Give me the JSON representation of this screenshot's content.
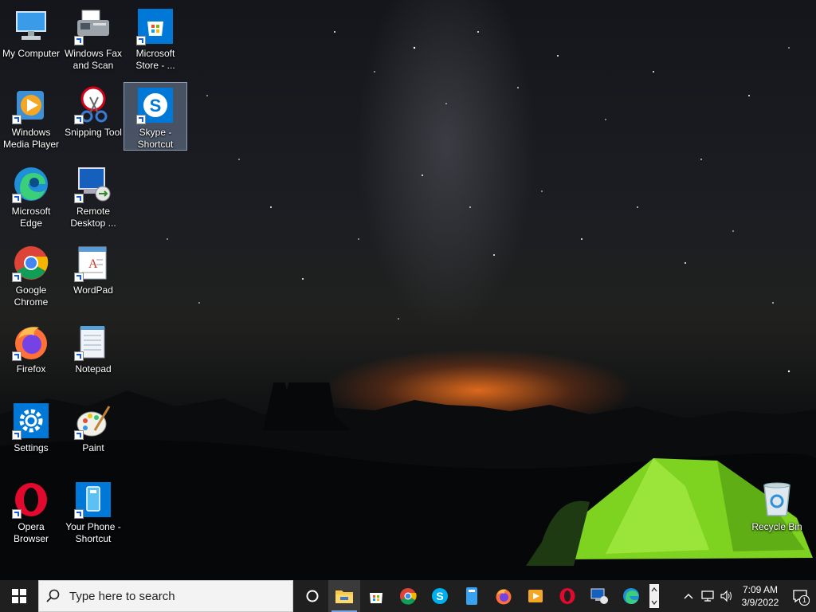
{
  "desktop": {
    "icons": [
      {
        "label": "My Computer",
        "icon": "computer-icon"
      },
      {
        "label": "Windows Fax\nand Scan",
        "icon": "fax-icon"
      },
      {
        "label": "Microsoft\nStore - ...",
        "icon": "store-icon"
      },
      {
        "label": "Windows\nMedia Player",
        "icon": "media-player-icon"
      },
      {
        "label": "Snipping Tool",
        "icon": "snipping-tool-icon"
      },
      {
        "label": "Skype -\nShortcut",
        "icon": "skype-icon"
      },
      {
        "label": "Microsoft\nEdge",
        "icon": "edge-icon"
      },
      {
        "label": "Remote\nDesktop ...",
        "icon": "remote-desktop-icon"
      },
      {
        "label": "Google\nChrome",
        "icon": "chrome-icon"
      },
      {
        "label": "WordPad",
        "icon": "wordpad-icon"
      },
      {
        "label": "Firefox",
        "icon": "firefox-icon"
      },
      {
        "label": "Notepad",
        "icon": "notepad-icon"
      },
      {
        "label": "Settings",
        "icon": "settings-icon"
      },
      {
        "label": "Paint",
        "icon": "paint-icon"
      },
      {
        "label": "Opera\nBrowser",
        "icon": "opera-icon"
      },
      {
        "label": "Your Phone -\nShortcut",
        "icon": "phone-icon"
      },
      {
        "label": "Recycle Bin",
        "icon": "recycle-bin-icon"
      }
    ],
    "selected": "Skype -\nShortcut"
  },
  "taskbar": {
    "search_placeholder": "Type here to search",
    "pinned": [
      "cortana-icon",
      "file-explorer-icon",
      "store-icon",
      "chrome-icon",
      "skype-icon",
      "phone-icon",
      "firefox-icon",
      "media-player-icon",
      "opera-icon",
      "remote-desktop-icon",
      "edge-icon"
    ],
    "active_app": "file-explorer-icon",
    "time": "7:09 AM",
    "date": "3/9/2022",
    "notification_count": "1"
  },
  "colors": {
    "taskbar": "#1f1f1f",
    "accent": "#0078d7"
  }
}
